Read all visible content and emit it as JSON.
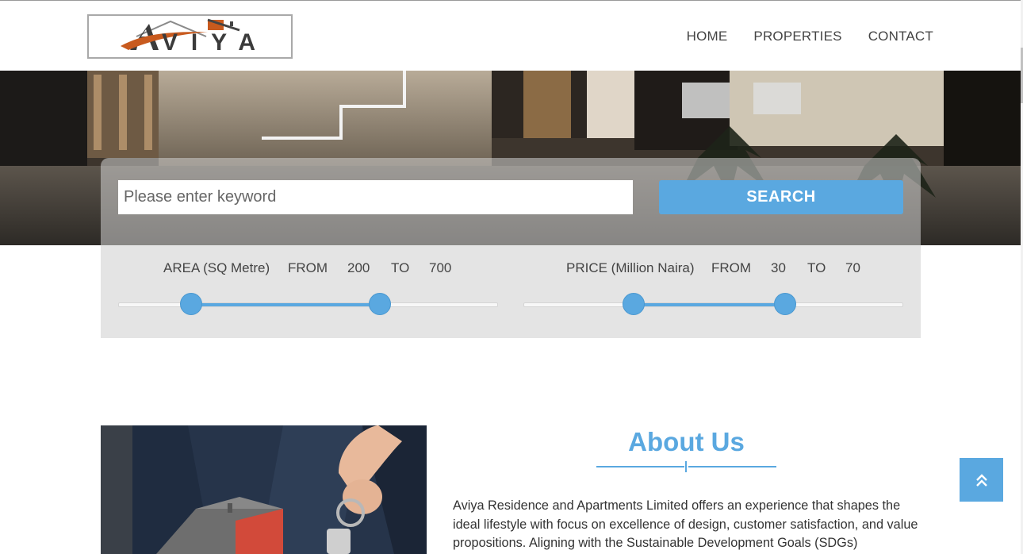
{
  "brand": {
    "logo_text": "AVIYA"
  },
  "nav": {
    "home": "HOME",
    "properties": "PROPERTIES",
    "contact": "CONTACT"
  },
  "search": {
    "placeholder": "Please enter keyword",
    "value": "",
    "button_label": "SEARCH"
  },
  "area_filter": {
    "label": "AREA (SQ Metre)",
    "from_label": "FROM",
    "from_value": "200",
    "to_label": "TO",
    "to_value": "700",
    "slider_low_fraction": 0.19,
    "slider_high_fraction": 0.69
  },
  "price_filter": {
    "label": "PRICE (Million Naira)",
    "from_label": "FROM",
    "from_value": "30",
    "to_label": "TO",
    "to_value": "70",
    "slider_low_fraction": 0.29,
    "slider_high_fraction": 0.69
  },
  "about": {
    "title": "About Us",
    "text": "Aviya Residence and Apartments Limited offers an experience that shapes the ideal lifestyle with focus on excellence of design, customer satisfaction, and value propositions. Aligning with the Sustainable Development Goals (SDGs)"
  },
  "icons": {
    "back_to_top": "double-chevron-up-icon"
  },
  "colors": {
    "accent": "#5aa8e0",
    "panel": "#e4e4e4",
    "nav_text": "#444444"
  }
}
